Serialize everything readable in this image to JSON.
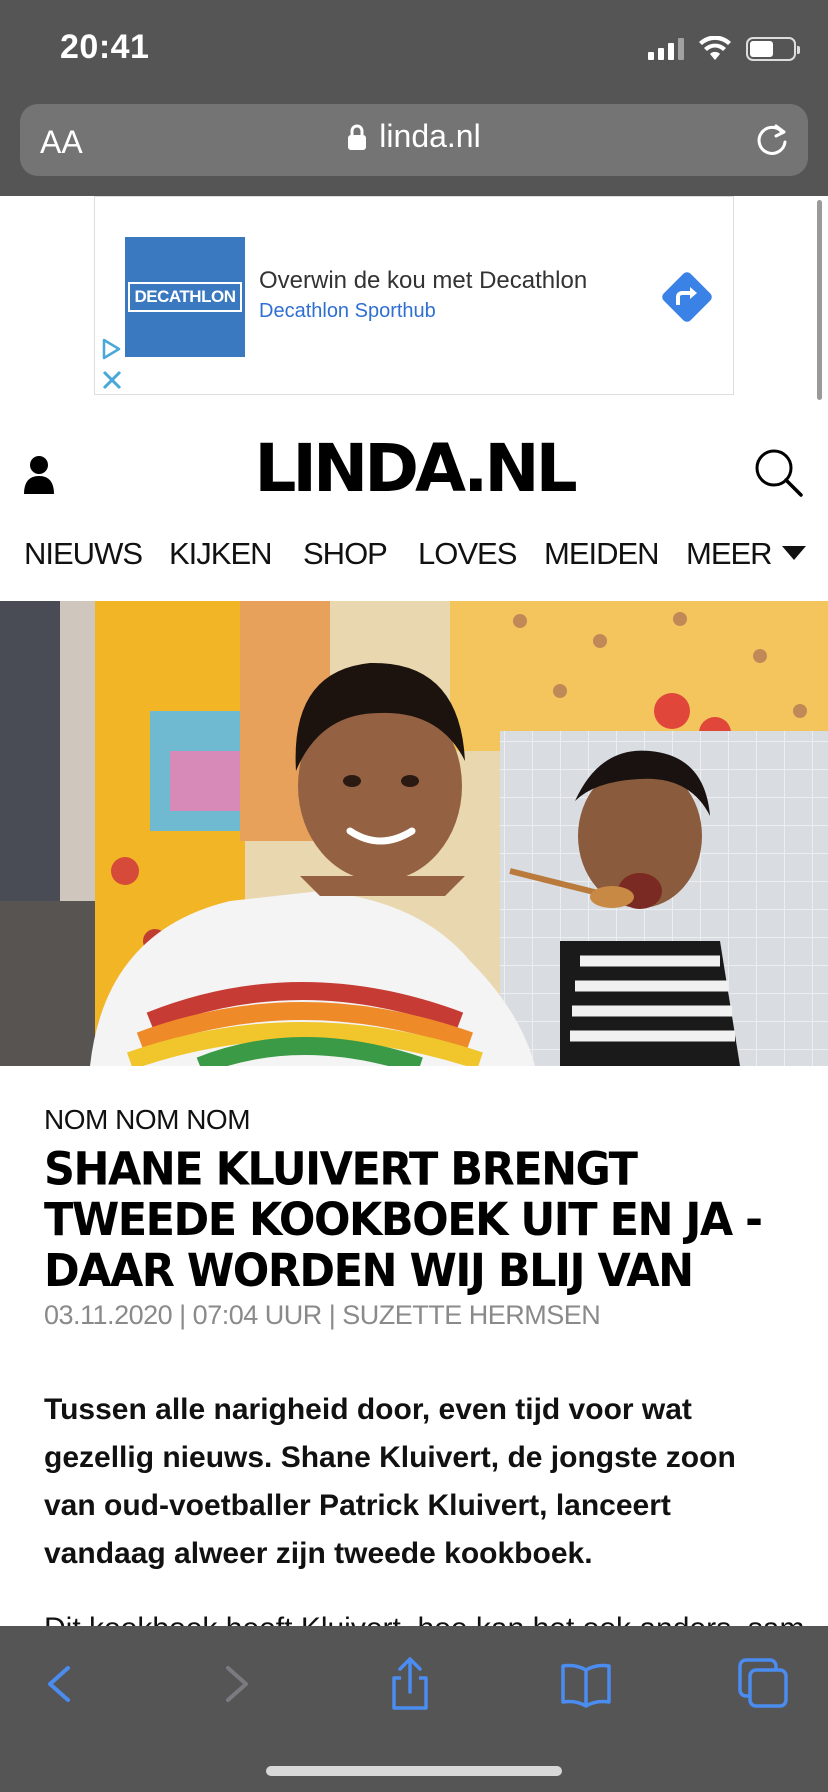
{
  "status_bar": {
    "time": "20:41"
  },
  "url_bar": {
    "text_size_label": "AA",
    "domain": "linda.nl"
  },
  "ad": {
    "logo_text": "DECATHLON",
    "headline": "Overwin de kou met Decathlon",
    "subline": "Decathlon Sporthub",
    "colors": {
      "brand": "#3a79c0",
      "link": "#2f6fd1",
      "arrow": "#3b82e6"
    }
  },
  "header": {
    "logo": "LINDA.NL"
  },
  "nav": {
    "items": [
      "NIEUWS",
      "KIJKEN",
      "SHOP",
      "LOVES",
      "MEIDEN"
    ],
    "more_label": "MEER"
  },
  "article": {
    "kicker": "NOM NOM NOM",
    "title": "SHANE KLUIVERT BRENGT TWEEDE KOOKBOEK UIT EN JA - DAAR WORDEN WIJ BLIJ VAN",
    "date": "03.11.2020",
    "time": "07:04 UUR",
    "author": "SUZETTE HERMSEN",
    "lead": "Tussen alle narigheid door, even tijd voor wat gezellig nieuws. Shane Kluivert, de jongste zoon van oud-voetballer Patrick Kluivert, lanceert vandaag alweer zijn tweede kookboek.",
    "next_paragraph": "Dit kookboek heeft Kluivert, hoe kan het ook anders, samen met zijn ..."
  },
  "toolbar": {
    "icons": [
      "back-icon",
      "forward-icon",
      "share-icon",
      "bookmarks-icon",
      "tabs-icon"
    ],
    "accent": "#3b82f6"
  }
}
